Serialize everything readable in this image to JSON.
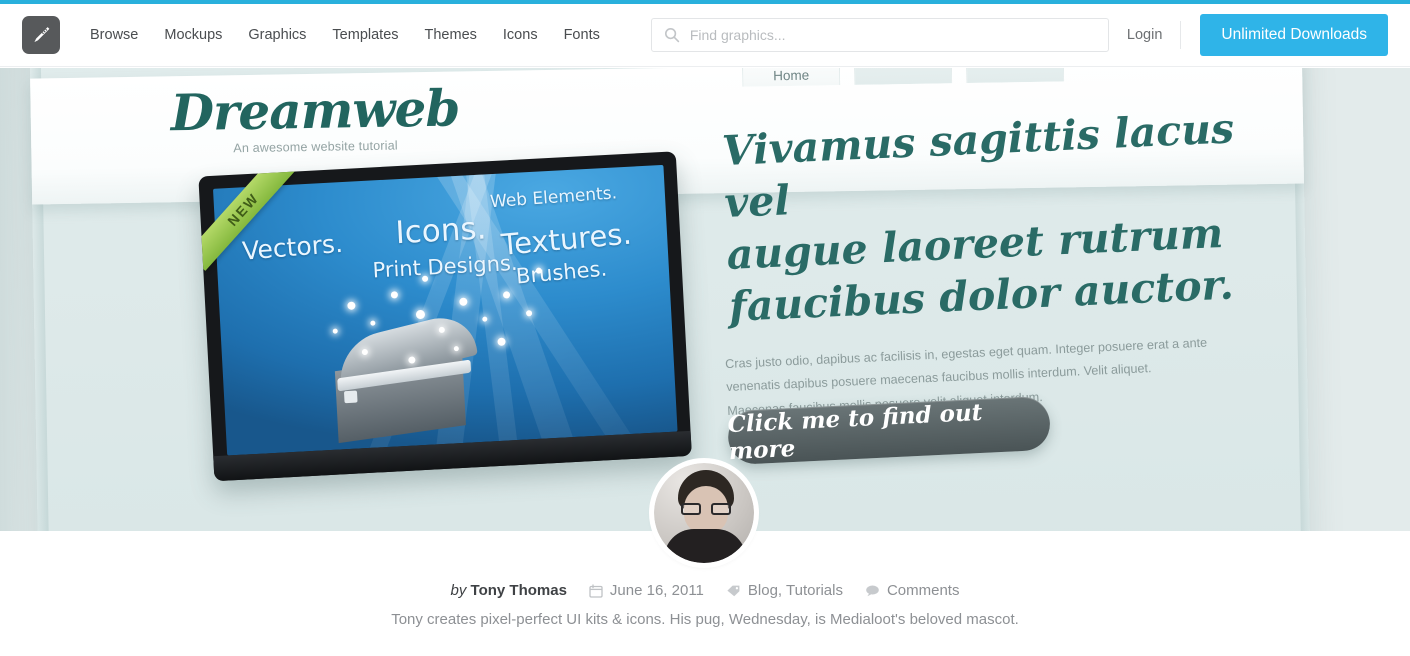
{
  "header": {
    "logo_icon": "pencil-logo-icon",
    "nav": [
      {
        "label": "Browse"
      },
      {
        "label": "Mockups"
      },
      {
        "label": "Graphics"
      },
      {
        "label": "Templates"
      },
      {
        "label": "Themes"
      },
      {
        "label": "Icons"
      },
      {
        "label": "Fonts"
      }
    ],
    "search": {
      "icon": "search-icon",
      "placeholder": "Find graphics...",
      "value": ""
    },
    "login_label": "Login",
    "cta_label": "Unlimited Downloads",
    "accent_color": "#2fb4e8",
    "top_strip_color": "#29b0dc"
  },
  "hero": {
    "brand": {
      "name": "Dreamweb",
      "tagline": "An awesome website tutorial",
      "color": "#22655f"
    },
    "tabs": [
      {
        "label": "Home"
      },
      {
        "label": ""
      },
      {
        "label": ""
      }
    ],
    "device": {
      "ribbon_label": "NEW",
      "screen_words": [
        {
          "text": "Vectors."
        },
        {
          "text": "Icons."
        },
        {
          "text": "Web Elements."
        },
        {
          "text": "Textures."
        },
        {
          "text": "Print Designs."
        },
        {
          "text": "Brushes."
        }
      ]
    },
    "headline_lines": [
      "Vivamus sagittis lacus vel",
      "augue laoreet rutrum",
      "faucibus dolor auctor."
    ],
    "paragraph_lines": [
      "Cras justo odio, dapibus ac facilisis in, egestas eget quam. Integer posuere erat a ante",
      "venenatis dapibus posuere maecenas faucibus mollis interdum. Velit aliquet.",
      "Maecenas faucibus mollis posuere velit aliquet interdum."
    ],
    "button_label": "Click me to find out more"
  },
  "caption": {
    "avatar_alt": "Tony Thomas avatar",
    "by_prefix": "by",
    "author": "Tony Thomas",
    "date_icon": "calendar-icon",
    "date": "June 16, 2011",
    "tag_icon": "tag-icon",
    "categories": "Blog, Tutorials",
    "comments_icon": "comment-icon",
    "comments": "Comments",
    "description": "Tony creates pixel-perfect UI kits & icons. His pug, Wednesday, is Medialoot's beloved mascot."
  }
}
